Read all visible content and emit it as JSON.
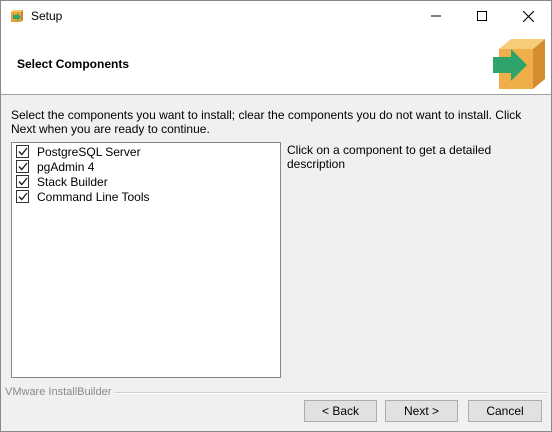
{
  "window": {
    "title": "Setup",
    "controls": {
      "minimize": "minimize-icon",
      "maximize": "maximize-icon",
      "close": "close-icon"
    }
  },
  "header": {
    "title": "Select Components",
    "logo_icon": "installer-box-arrow-icon"
  },
  "instructions": "Select the components you want to install; clear the components you do not want to install. Click Next when you are ready to continue.",
  "components": [
    {
      "label": "PostgreSQL Server",
      "checked": true
    },
    {
      "label": "pgAdmin 4",
      "checked": true
    },
    {
      "label": "Stack Builder",
      "checked": true
    },
    {
      "label": "Command Line Tools",
      "checked": true
    }
  ],
  "description": "Click on a component to get a detailed description",
  "footer": {
    "brand": "VMware InstallBuilder",
    "back_label": "< Back",
    "next_label": "Next >",
    "cancel_label": "Cancel"
  },
  "colors": {
    "window_bg": "#f0f0f0",
    "header_bg": "#ffffff",
    "logo_box": "#f0b54a",
    "logo_arrow": "#2ea36a"
  }
}
